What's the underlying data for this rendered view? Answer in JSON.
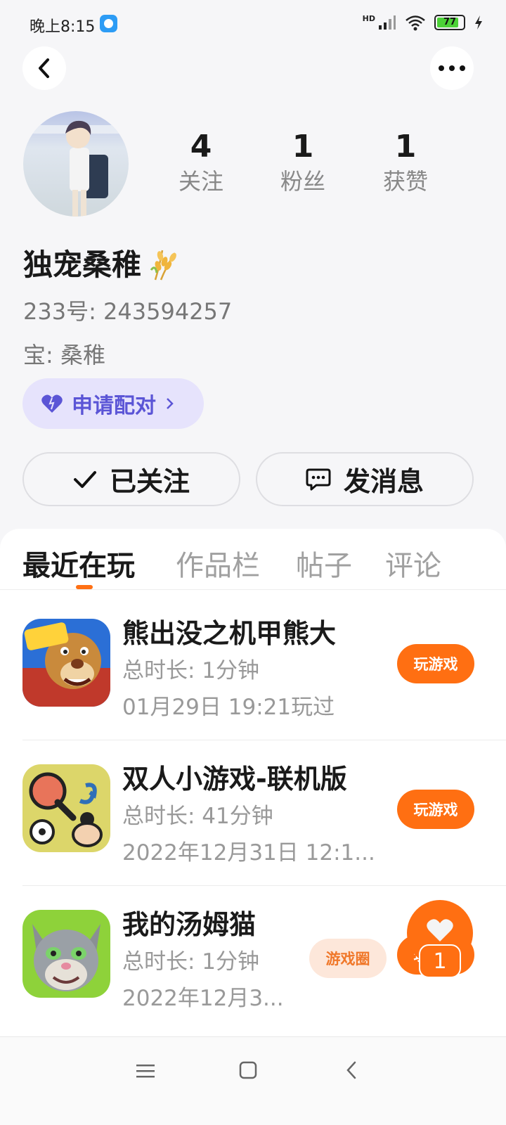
{
  "status_bar": {
    "time": "晚上8:15",
    "network": "HD",
    "battery": "77"
  },
  "profile": {
    "stats": [
      {
        "value": "4",
        "label": "关注"
      },
      {
        "value": "1",
        "label": "粉丝"
      },
      {
        "value": "1",
        "label": "获赞"
      }
    ],
    "nickname": "独宠桑稚",
    "user_id": "233号: 243594257",
    "partner": "宝: 桑稚",
    "pair_button": "申请配对",
    "follow_button": "已关注",
    "message_button": "发消息"
  },
  "tabs": [
    "最近在玩",
    "作品栏",
    "帖子",
    "评论"
  ],
  "games": [
    {
      "name": "熊出没之机甲熊大",
      "duration": "总时长: 1分钟",
      "last_played": "01月29日 19:21玩过",
      "button": "玩游戏"
    },
    {
      "name": "双人小游戏-联机版",
      "duration": "总时长: 41分钟",
      "last_played": "2022年12月31日 12:1...",
      "button": "玩游戏"
    },
    {
      "name": "我的汤姆猫",
      "duration": "总时长: 1分钟",
      "last_played": "2022年12月3...",
      "circle_button": "游戏圈",
      "button": "玩游戏"
    }
  ],
  "like_fab": {
    "count": "1"
  },
  "colors": {
    "accent": "#ff6f12",
    "pair_bg": "#e6e3fc",
    "pair_text": "#5b55d6"
  }
}
